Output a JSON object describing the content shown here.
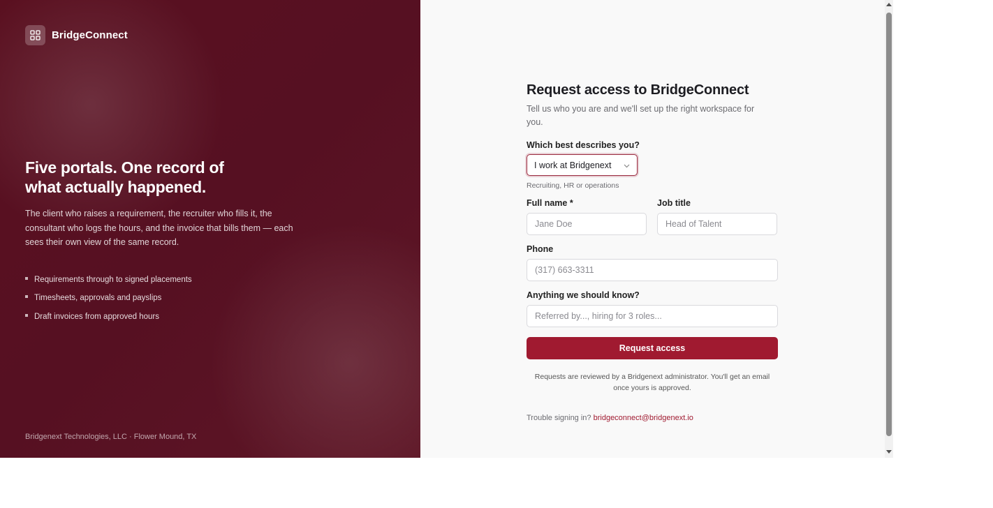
{
  "brand": {
    "name": "BridgeConnect",
    "icon": "grid-icon"
  },
  "hero": {
    "title": "Five portals. One record of what actually happened.",
    "description": "The client who raises a requirement, the recruiter who fills it, the consultant who logs the hours, and the invoice that bills them — each sees their own view of the same record.",
    "features": [
      "Requirements through to signed placements",
      "Timesheets, approvals and payslips",
      "Draft invoices from approved hours"
    ]
  },
  "footer": {
    "company": "Bridgenext Technologies, LLC · Flower Mound, TX"
  },
  "form": {
    "title": "Request access to BridgeConnect",
    "subtitle": "Tell us who you are and we'll set up the right workspace for you.",
    "role_label": "Which best describes you?",
    "role_value": "I work at Bridgenext",
    "role_hint": "Recruiting, HR or operations",
    "fullname_label": "Full name *",
    "fullname_placeholder": "Jane Doe",
    "jobtitle_label": "Job title",
    "jobtitle_placeholder": "Head of Talent",
    "phone_label": "Phone",
    "phone_placeholder": "(317) 663-3311",
    "notes_label": "Anything we should know?",
    "notes_placeholder": "Referred by..., hiring for 3 roles...",
    "submit_label": "Request access",
    "review_note": "Requests are reviewed by a Bridgenext administrator. You'll get an email once yours is approved.",
    "trouble_text": "Trouble signing in?",
    "support_email": "bridgeconnect@bridgenext.io"
  },
  "colors": {
    "accent": "#a01a30",
    "panel": "#561022",
    "form_bg": "#f9f9f9"
  }
}
